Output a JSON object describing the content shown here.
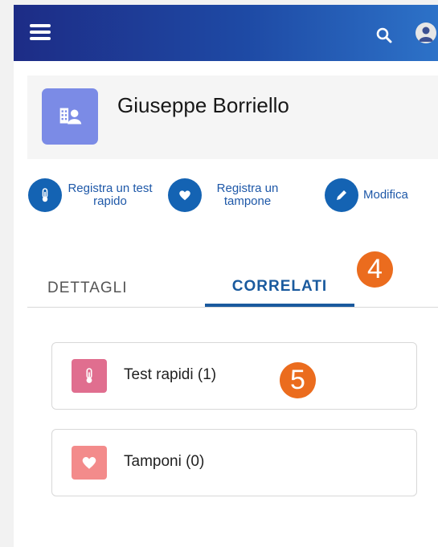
{
  "header": {
    "menu_icon": "hamburger-menu-icon",
    "search_icon": "search-icon",
    "user_icon": "user-avatar-icon"
  },
  "record": {
    "title": "Giuseppe Borriello",
    "icon": "building-person-icon"
  },
  "actions": [
    {
      "line1": "Registra un test",
      "line2": "rapido",
      "icon": "thermometer-icon"
    },
    {
      "line1": "Registra un",
      "line2": "tampone",
      "icon": "heart-icon"
    },
    {
      "label": "Modifica",
      "icon": "pencil-icon"
    }
  ],
  "tabs": [
    {
      "label": "DETTAGLI",
      "active": false
    },
    {
      "label": "CORRELATI",
      "active": true
    }
  ],
  "annotations": {
    "badge_tabs": "4",
    "badge_card": "5",
    "badge_color": "#eb6c1e"
  },
  "related": [
    {
      "label": "Test rapidi (1)",
      "icon": "thermometer-icon",
      "color": "#e06e8f"
    },
    {
      "label": "Tamponi (0)",
      "icon": "heart-icon",
      "color": "#f38b8b"
    }
  ],
  "colors": {
    "header_start": "#1d2c86",
    "header_end": "#2d72c8",
    "accent": "#1463b3",
    "tab_active": "#1a5a9e"
  }
}
